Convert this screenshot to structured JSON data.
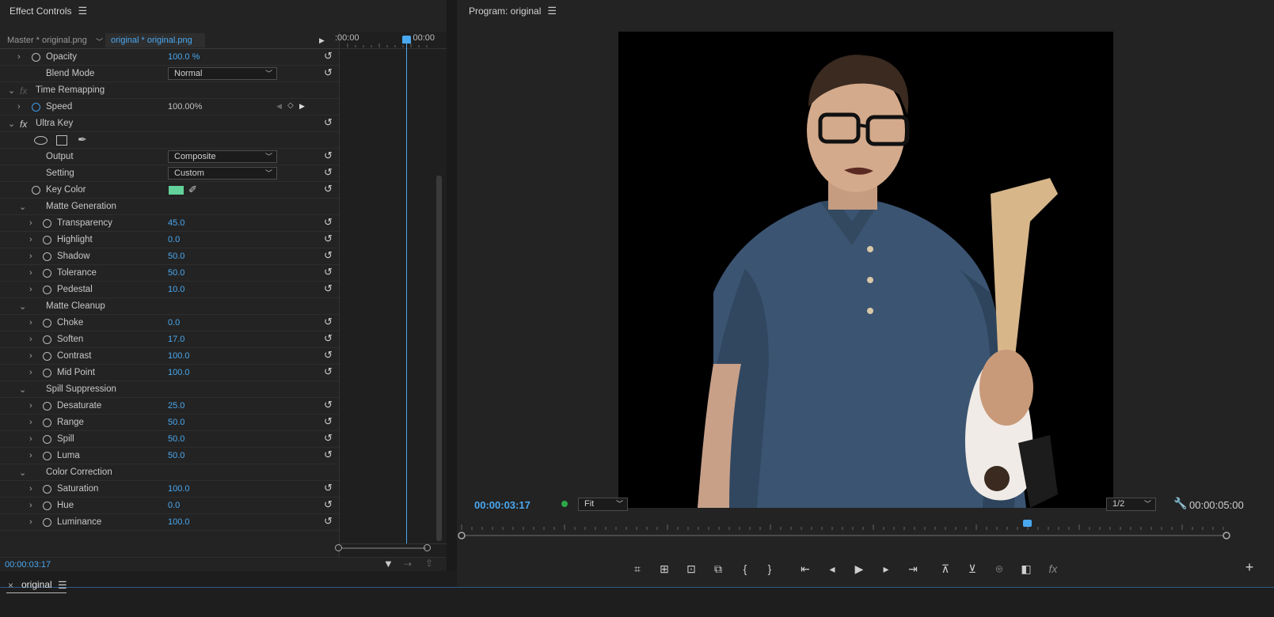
{
  "effect_controls": {
    "title": "Effect Controls",
    "master_tab": "Master * original.png",
    "clip_tab": "original * original.png",
    "timeline_start": ":00:00",
    "timeline_end": "00:00",
    "current_time": "00:00:03:17",
    "opacity": {
      "label": "Opacity",
      "value": "100.0 %"
    },
    "blend_mode": {
      "label": "Blend Mode",
      "value": "Normal"
    },
    "time_remapping": {
      "label": "Time Remapping"
    },
    "speed": {
      "label": "Speed",
      "value": "100.00%"
    },
    "ultra_key": {
      "label": "Ultra Key"
    },
    "output": {
      "label": "Output",
      "value": "Composite"
    },
    "setting": {
      "label": "Setting",
      "value": "Custom"
    },
    "key_color": {
      "label": "Key Color",
      "color": "#62d19a"
    },
    "matte_generation": {
      "label": "Matte Generation",
      "params": [
        {
          "label": "Transparency",
          "value": "45.0"
        },
        {
          "label": "Highlight",
          "value": "0.0"
        },
        {
          "label": "Shadow",
          "value": "50.0"
        },
        {
          "label": "Tolerance",
          "value": "50.0"
        },
        {
          "label": "Pedestal",
          "value": "10.0"
        }
      ]
    },
    "matte_cleanup": {
      "label": "Matte Cleanup",
      "params": [
        {
          "label": "Choke",
          "value": "0.0"
        },
        {
          "label": "Soften",
          "value": "17.0"
        },
        {
          "label": "Contrast",
          "value": "100.0"
        },
        {
          "label": "Mid Point",
          "value": "100.0"
        }
      ]
    },
    "spill_suppression": {
      "label": "Spill Suppression",
      "params": [
        {
          "label": "Desaturate",
          "value": "25.0"
        },
        {
          "label": "Range",
          "value": "50.0"
        },
        {
          "label": "Spill",
          "value": "50.0"
        },
        {
          "label": "Luma",
          "value": "50.0"
        }
      ]
    },
    "color_correction": {
      "label": "Color Correction",
      "params": [
        {
          "label": "Saturation",
          "value": "100.0"
        },
        {
          "label": "Hue",
          "value": "0.0"
        },
        {
          "label": "Luminance",
          "value": "100.0"
        }
      ]
    }
  },
  "program_monitor": {
    "title": "Program: original",
    "timecode": "00:00:03:17",
    "zoom": "Fit",
    "resolution": "1/2",
    "duration": "00:00:05:00"
  },
  "timeline": {
    "tab_close": "×",
    "tab_label": "original"
  },
  "colors": {
    "accent": "#4aa8f0",
    "status_dot": "#2ea84a",
    "key_color_swatch": "#62d19a"
  }
}
